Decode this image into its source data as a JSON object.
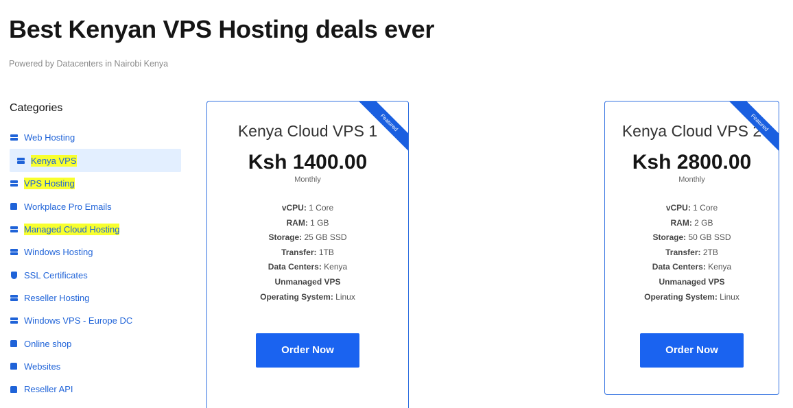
{
  "header": {
    "title": "Best Kenyan VPS Hosting deals ever",
    "subtitle": "Powered by Datacenters in Nairobi Kenya"
  },
  "sidebar": {
    "heading": "Categories",
    "items": [
      {
        "label": "Web Hosting",
        "icon": "server-icon"
      },
      {
        "label": "Kenya VPS",
        "icon": "server-icon",
        "active": true,
        "highlighted": true
      },
      {
        "label": "VPS Hosting",
        "icon": "server-icon",
        "highlighted": true
      },
      {
        "label": "Workplace Pro Emails",
        "icon": "box-icon"
      },
      {
        "label": "Managed Cloud Hosting",
        "icon": "server-icon",
        "highlighted": true
      },
      {
        "label": "Windows Hosting",
        "icon": "server-icon"
      },
      {
        "label": "SSL Certificates",
        "icon": "shield-icon"
      },
      {
        "label": "Reseller Hosting",
        "icon": "server-icon"
      },
      {
        "label": "Windows VPS - Europe DC",
        "icon": "server-icon"
      },
      {
        "label": "Online shop",
        "icon": "box-icon"
      },
      {
        "label": "Websites",
        "icon": "box-icon"
      },
      {
        "label": "Reseller API",
        "icon": "box-icon"
      }
    ]
  },
  "products": [
    {
      "ribbon": "Featured",
      "name": "Kenya Cloud VPS 1",
      "price": "Ksh 1400.00",
      "period": "Monthly",
      "features": [
        {
          "label": "vCPU:",
          "value": " 1 Core"
        },
        {
          "label": "RAM:",
          "value": " 1 GB"
        },
        {
          "label": "Storage:",
          "value": " 25 GB SSD"
        },
        {
          "label": "Transfer:",
          "value": " 1TB"
        },
        {
          "label": "Data Centers:",
          "value": " Kenya"
        },
        {
          "label": "Unmanaged VPS",
          "value": ""
        },
        {
          "label": "Operating System:",
          "value": " Linux"
        }
      ],
      "button": "Order Now"
    },
    {
      "ribbon": "Featured",
      "name": "Kenya Cloud VPS 2",
      "price": "Ksh 2800.00",
      "period": "Monthly",
      "features": [
        {
          "label": "vCPU:",
          "value": " 1 Core"
        },
        {
          "label": "RAM:",
          "value": " 2 GB"
        },
        {
          "label": "Storage:",
          "value": " 50 GB SSD"
        },
        {
          "label": "Transfer:",
          "value": " 2TB"
        },
        {
          "label": "Data Centers:",
          "value": " Kenya"
        },
        {
          "label": "Unmanaged VPS",
          "value": ""
        },
        {
          "label": "Operating System:",
          "value": " Linux"
        }
      ],
      "button": "Order Now"
    }
  ],
  "colors": {
    "accent": "#1a63f0",
    "link": "#1f63d8",
    "active_bg": "#e3efff",
    "highlight": "#f8ff2e"
  }
}
